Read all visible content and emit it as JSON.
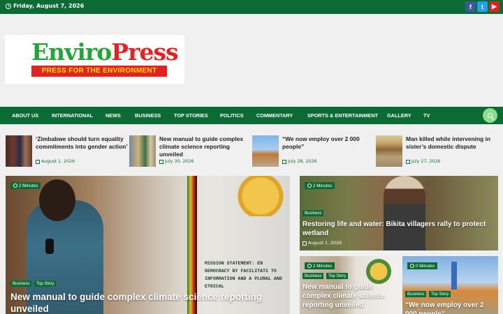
{
  "topbar": {
    "date": "Friday, August 7, 2026",
    "social": [
      {
        "name": "facebook-icon",
        "glyph": "f"
      },
      {
        "name": "twitter-icon",
        "glyph": "t"
      },
      {
        "name": "youtube-icon",
        "glyph": "▶"
      }
    ]
  },
  "logo": {
    "title_green": "Enviro",
    "title_red": "Press",
    "tagline": "PRESS FOR THE ENVIRONMENT"
  },
  "nav": {
    "items": [
      "ABOUT US",
      "INTERNATIONAL",
      "NEWS",
      "BUSINESS",
      "TOP STORIES",
      "POLITICS",
      "COMMENTARY",
      "SPORTS & ENTERTAINMENT",
      "GALLERY",
      "TV"
    ],
    "search_icon": "search-icon"
  },
  "ticker": [
    {
      "title": "‘Zimbabwe should turn equality commitments into gender action’",
      "date": "August 1, 2026"
    },
    {
      "title": "New manual to guide complex climate science reporting unveiled",
      "date": "July 30, 2026"
    },
    {
      "title": "“We now employ over 2 000 people”",
      "date": "July 28, 2026"
    },
    {
      "title": "Man killed while intervening in sister’s domestic dispute",
      "date": "July 27, 2026"
    }
  ],
  "feature": {
    "read_time": "2 Minutes",
    "tags": [
      "Business",
      "Top Story"
    ],
    "title": "New manual to guide complex climate science reporting unveiled",
    "banner_text": "MISSION STATEMENT: EN DEMOCRACY BY FACILITATI TO INFORMATION AND A PLURAL AND ETHICAL"
  },
  "side_top": {
    "read_time": "2 Minutes",
    "tag": "Business",
    "title": "Restoring life and water: Bikita villagers rally to protect wetland",
    "date": "August 1, 2026"
  },
  "side_left": {
    "read_time": "2 Minutes",
    "tags": [
      "Business",
      "Top Story"
    ],
    "title": "New manual to guide complex climate science reporting unveiled"
  },
  "side_right": {
    "read_time": "0 Minutes",
    "tags": [
      "Business",
      "Top Story"
    ],
    "title": "“We now employ over 2 000 people”"
  },
  "colors": {
    "brand_green": "#0c6b35",
    "logo_green": "#23a637",
    "logo_red": "#e42221",
    "search_bg": "#8fdc8f"
  }
}
